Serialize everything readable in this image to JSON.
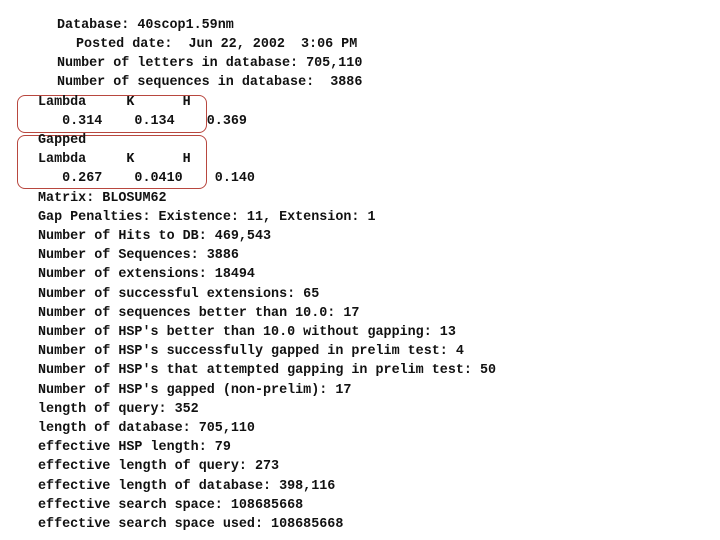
{
  "header": {
    "database": "Database: 40scop1.59nm",
    "posted_date": "Posted date:  Jun 22, 2002  3:06 PM",
    "letters": "Number of letters in database: 705,110",
    "sequences": "Number of sequences in database:  3886"
  },
  "ungapped": {
    "header_row": "Lambda     K      H",
    "value_row": "   0.314    0.134    0.369"
  },
  "gapped": {
    "label": "Gapped",
    "header_row": "Lambda     K      H",
    "value_row": "   0.267    0.0410    0.140"
  },
  "stats": [
    "Matrix: BLOSUM62",
    "Gap Penalties: Existence: 11, Extension: 1",
    "Number of Hits to DB: 469,543",
    "Number of Sequences: 3886",
    "Number of extensions: 18494",
    "Number of successful extensions: 65",
    "Number of sequences better than 10.0: 17",
    "Number of HSP's better than 10.0 without gapping: 13",
    "Number of HSP's successfully gapped in prelim test: 4",
    "Number of HSP's that attempted gapping in prelim test: 50",
    "Number of HSP's gapped (non-prelim): 17",
    "length of query: 352",
    "length of database: 705,110",
    "effective HSP length: 79",
    "effective length of query: 273",
    "effective length of database: 398,116",
    "effective search space: 108685668",
    "effective search space used: 108685668"
  ],
  "colors": {
    "highlight_box": "#b8473f",
    "text": "#111111"
  }
}
